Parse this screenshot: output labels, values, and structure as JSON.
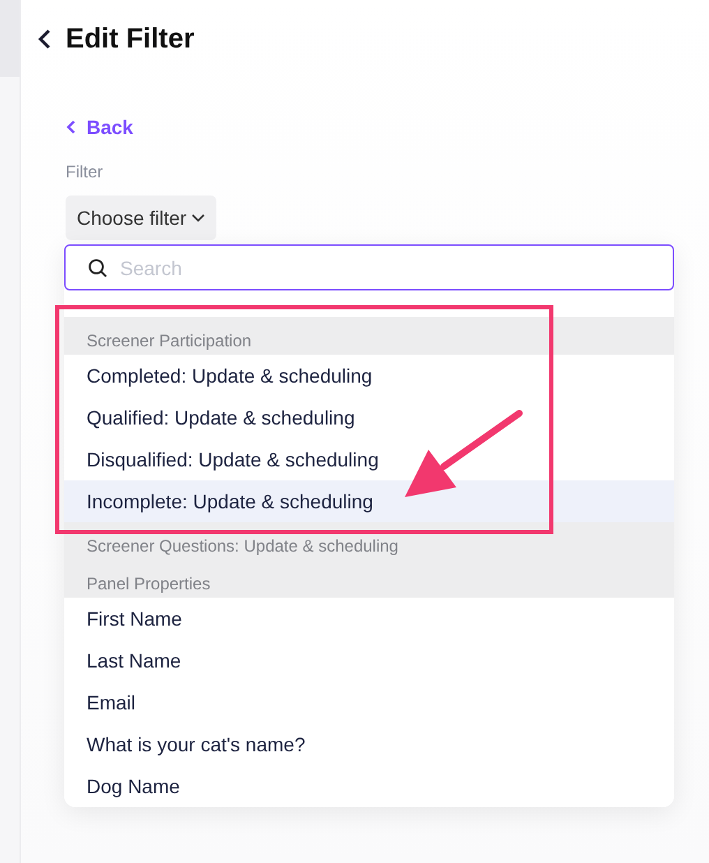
{
  "header": {
    "title": "Edit Filter"
  },
  "back_link": "Back",
  "filter": {
    "label": "Filter",
    "button": "Choose filter"
  },
  "dropdown": {
    "search": {
      "placeholder": "Search"
    },
    "items": [
      {
        "kind": "spacer"
      },
      {
        "kind": "group",
        "label": "Screener Participation"
      },
      {
        "kind": "option",
        "label": "Completed: Update & scheduling",
        "selected": false
      },
      {
        "kind": "option",
        "label": "Qualified: Update & scheduling",
        "selected": false
      },
      {
        "kind": "option",
        "label": "Disqualified: Update & scheduling",
        "selected": false
      },
      {
        "kind": "option",
        "label": "Incomplete: Update & scheduling",
        "selected": true
      },
      {
        "kind": "group",
        "label": "Screener Questions: Update & scheduling"
      },
      {
        "kind": "group",
        "label": "Panel Properties"
      },
      {
        "kind": "option",
        "label": "First Name",
        "selected": false
      },
      {
        "kind": "option",
        "label": "Last Name",
        "selected": false
      },
      {
        "kind": "option",
        "label": "Email",
        "selected": false
      },
      {
        "kind": "option",
        "label": "What is your cat's name?",
        "selected": false
      },
      {
        "kind": "option",
        "label": "Dog Name",
        "selected": false
      }
    ]
  },
  "annotations": {
    "highlight_box": true,
    "arrow": true
  }
}
